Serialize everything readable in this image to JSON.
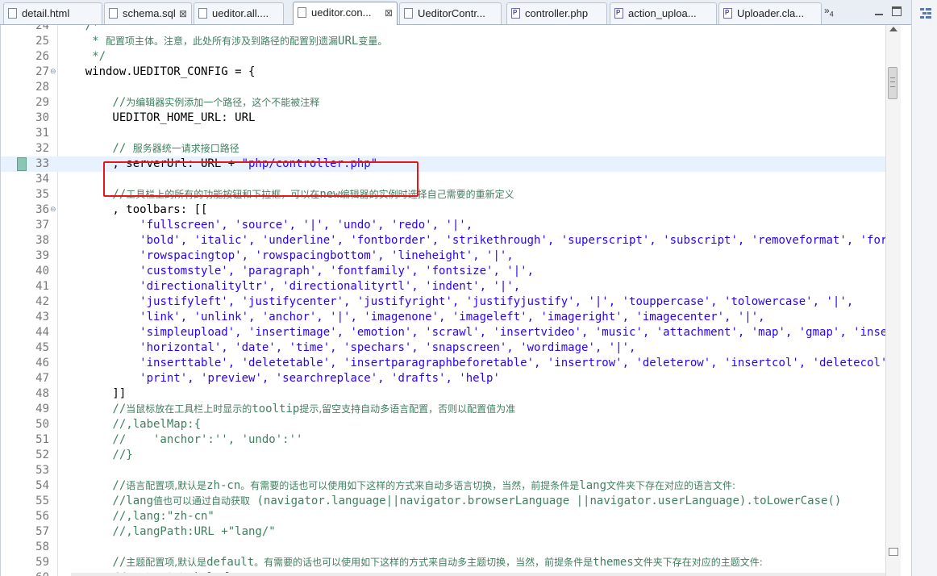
{
  "tabs": [
    {
      "label": "detail.html",
      "icon": "file-icon",
      "active": false
    },
    {
      "label": "schema.sql",
      "icon": "file-icon",
      "active": false,
      "close": "⊠"
    },
    {
      "label": "ueditor.all....",
      "icon": "file-icon",
      "active": false
    },
    {
      "label": "ueditor.con...",
      "icon": "file-icon",
      "active": true,
      "close": "⊠"
    },
    {
      "label": "UeditorContr...",
      "icon": "file-icon",
      "active": false
    },
    {
      "label": "controller.php",
      "icon": "php-file-icon",
      "active": false
    },
    {
      "label": "action_uploa...",
      "icon": "php-file-icon",
      "active": false
    },
    {
      "label": "Uploader.cla...",
      "icon": "php-file-icon",
      "active": false
    }
  ],
  "tab_overflow": {
    "label": "»",
    "count": "4"
  },
  "editor": {
    "highlight_color": "#e8161b",
    "current_line": "33",
    "lines": [
      {
        "n": "24",
        "segs": [
          {
            "t": "    /*",
            "k": "c"
          }
        ]
      },
      {
        "n": "25",
        "segs": [
          {
            "t": "     * ",
            "k": "c"
          },
          {
            "t": "配置项主体。注意，此处所有涉及到路径的配置别遗漏",
            "k": "c cn"
          },
          {
            "t": "URL",
            "k": "c"
          },
          {
            "t": "变量。",
            "k": "c cn"
          }
        ]
      },
      {
        "n": "26",
        "segs": [
          {
            "t": "     */",
            "k": "c"
          }
        ]
      },
      {
        "n": "27",
        "fold": "⊖",
        "segs": [
          {
            "t": "    window.UEDITOR_CONFIG = {",
            "k": ""
          }
        ]
      },
      {
        "n": "28",
        "segs": []
      },
      {
        "n": "29",
        "segs": [
          {
            "t": "        //",
            "k": "c"
          },
          {
            "t": "为编辑器实例添加一个路径，这个不能被注释",
            "k": "c cn"
          }
        ]
      },
      {
        "n": "30",
        "segs": [
          {
            "t": "        UEDITOR_HOME_URL: URL",
            "k": ""
          }
        ]
      },
      {
        "n": "31",
        "segs": []
      },
      {
        "n": "32",
        "segs": [
          {
            "t": "        // ",
            "k": "c"
          },
          {
            "t": "服务器统一请求接口路径",
            "k": "c cn"
          }
        ]
      },
      {
        "n": "33",
        "current": true,
        "marker": true,
        "segs": [
          {
            "t": "        , serverUrl: URL + ",
            "k": ""
          },
          {
            "t": "\"php/controller.php\"",
            "k": "s"
          }
        ]
      },
      {
        "n": "34",
        "segs": []
      },
      {
        "n": "35",
        "segs": [
          {
            "t": "        //",
            "k": "c"
          },
          {
            "t": "工具栏上的所有的功能按钮和下拉框，可以在",
            "k": "c cn"
          },
          {
            "t": "new",
            "k": "c"
          },
          {
            "t": "编辑器的实例时选择自己需要的重新定义",
            "k": "c cn"
          }
        ]
      },
      {
        "n": "36",
        "fold": "⊖",
        "segs": [
          {
            "t": "        , toolbars: [[",
            "k": ""
          }
        ]
      },
      {
        "n": "37",
        "segs": [
          {
            "t": "            ",
            "k": ""
          },
          {
            "t": "'fullscreen', 'source', '|', 'undo', 'redo', '|',",
            "k": "s"
          }
        ]
      },
      {
        "n": "38",
        "segs": [
          {
            "t": "            ",
            "k": ""
          },
          {
            "t": "'bold', 'italic', 'underline', 'fontborder', 'strikethrough', 'superscript', 'subscript', 'removeformat', 'formatmatch',",
            "k": "s"
          }
        ]
      },
      {
        "n": "39",
        "segs": [
          {
            "t": "            ",
            "k": ""
          },
          {
            "t": "'rowspacingtop', 'rowspacingbottom', 'lineheight', '|',",
            "k": "s"
          }
        ]
      },
      {
        "n": "40",
        "segs": [
          {
            "t": "            ",
            "k": ""
          },
          {
            "t": "'customstyle', 'paragraph', 'fontfamily', 'fontsize', '|',",
            "k": "s"
          }
        ]
      },
      {
        "n": "41",
        "segs": [
          {
            "t": "            ",
            "k": ""
          },
          {
            "t": "'directionalityltr', 'directionalityrtl', 'indent', '|',",
            "k": "s"
          }
        ]
      },
      {
        "n": "42",
        "segs": [
          {
            "t": "            ",
            "k": ""
          },
          {
            "t": "'justifyleft', 'justifycenter', 'justifyright', 'justifyjustify', '|', 'touppercase', 'tolowercase', '|',",
            "k": "s"
          }
        ]
      },
      {
        "n": "43",
        "segs": [
          {
            "t": "            ",
            "k": ""
          },
          {
            "t": "'link', 'unlink', 'anchor', '|', 'imagenone', 'imageleft', 'imageright', 'imagecenter', '|',",
            "k": "s"
          }
        ]
      },
      {
        "n": "44",
        "segs": [
          {
            "t": "            ",
            "k": ""
          },
          {
            "t": "'simpleupload', 'insertimage', 'emotion', 'scrawl', 'insertvideo', 'music', 'attachment', 'map', 'gmap', 'insertframe',",
            "k": "s"
          }
        ]
      },
      {
        "n": "45",
        "segs": [
          {
            "t": "            ",
            "k": ""
          },
          {
            "t": "'horizontal', 'date', 'time', 'spechars', 'snapscreen', 'wordimage', '|',",
            "k": "s"
          }
        ]
      },
      {
        "n": "46",
        "segs": [
          {
            "t": "            ",
            "k": ""
          },
          {
            "t": "'inserttable', 'deletetable', 'insertparagraphbeforetable', 'insertrow', 'deleterow', 'insertcol', 'deletecol',",
            "k": "s"
          }
        ]
      },
      {
        "n": "47",
        "segs": [
          {
            "t": "            ",
            "k": ""
          },
          {
            "t": "'print', 'preview', 'searchreplace', 'drafts', 'help'",
            "k": "s"
          }
        ]
      },
      {
        "n": "48",
        "segs": [
          {
            "t": "        ]]",
            "k": ""
          }
        ]
      },
      {
        "n": "49",
        "segs": [
          {
            "t": "        //",
            "k": "c"
          },
          {
            "t": "当鼠标放在工具栏上时显示的",
            "k": "c cn"
          },
          {
            "t": "tooltip",
            "k": "c"
          },
          {
            "t": "提示,留空支持自动多语言配置，否则以配置值为准",
            "k": "c cn"
          }
        ]
      },
      {
        "n": "50",
        "segs": [
          {
            "t": "        //,labelMap:{",
            "k": "c"
          }
        ]
      },
      {
        "n": "51",
        "segs": [
          {
            "t": "        //    'anchor':'', 'undo':''",
            "k": "c"
          }
        ]
      },
      {
        "n": "52",
        "segs": [
          {
            "t": "        //}",
            "k": "c"
          }
        ]
      },
      {
        "n": "53",
        "segs": []
      },
      {
        "n": "54",
        "segs": [
          {
            "t": "        //",
            "k": "c"
          },
          {
            "t": "语言配置项,默认是",
            "k": "c cn"
          },
          {
            "t": "zh-cn",
            "k": "c"
          },
          {
            "t": "。有需要的话也可以使用如下这样的方式来自动多语言切换，当然，前提条件是",
            "k": "c cn"
          },
          {
            "t": "lang",
            "k": "c"
          },
          {
            "t": "文件夹下存在对应的语言文件:",
            "k": "c cn"
          }
        ]
      },
      {
        "n": "55",
        "segs": [
          {
            "t": "        //lang",
            "k": "c"
          },
          {
            "t": "值也可以通过自动获取",
            "k": "c cn"
          },
          {
            "t": " (navigator.language||navigator.browserLanguage ||navigator.userLanguage).toLowerCase()",
            "k": "c"
          }
        ]
      },
      {
        "n": "56",
        "segs": [
          {
            "t": "        //,lang:\"zh-cn\"",
            "k": "c"
          }
        ]
      },
      {
        "n": "57",
        "segs": [
          {
            "t": "        //,langPath:URL +\"lang/\"",
            "k": "c"
          }
        ]
      },
      {
        "n": "58",
        "segs": []
      },
      {
        "n": "59",
        "segs": [
          {
            "t": "        //",
            "k": "c"
          },
          {
            "t": "主题配置项,默认是",
            "k": "c cn"
          },
          {
            "t": "default",
            "k": "c"
          },
          {
            "t": "。有需要的话也可以使用如下这样的方式来自动多主题切换，当然，前提条件是",
            "k": "c cn"
          },
          {
            "t": "themes",
            "k": "c"
          },
          {
            "t": "文件夹下存在对应的主题文件:",
            "k": "c cn"
          }
        ]
      },
      {
        "n": "60",
        "segs": [
          {
            "t": "        //",
            "k": "c"
          },
          {
            "t": "现有如下皮肤",
            "k": "c cn"
          },
          {
            "t": ":default",
            "k": "c"
          }
        ]
      }
    ]
  }
}
